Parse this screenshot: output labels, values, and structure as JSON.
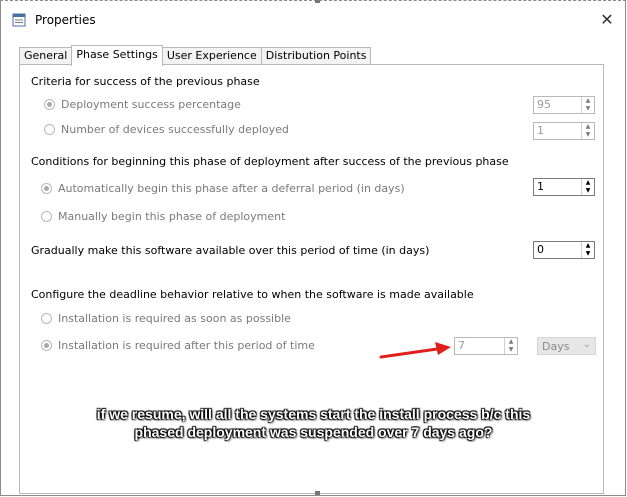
{
  "window": {
    "title": "Properties",
    "close_glyph": "✕"
  },
  "tabs": [
    {
      "label": "General",
      "active": false
    },
    {
      "label": "Phase Settings",
      "active": true
    },
    {
      "label": "User Experience",
      "active": false
    },
    {
      "label": "Distribution Points",
      "active": false
    }
  ],
  "criteria": {
    "heading": "Criteria for success of the previous phase",
    "option_percentage": "Deployment success percentage",
    "option_devices": "Number of devices successfully deployed",
    "percentage_value": "95",
    "devices_value": "1"
  },
  "conditions": {
    "heading": "Conditions for beginning this phase of deployment after success of the previous phase",
    "option_auto": "Automatically begin this phase after a deferral period (in days)",
    "option_manual": "Manually begin this phase of deployment",
    "deferral_value": "1"
  },
  "gradual": {
    "label": "Gradually make this software available over this period of time (in days)",
    "value": "0"
  },
  "deadline": {
    "heading": "Configure the deadline behavior relative to when the software is made available",
    "option_asap": "Installation is required as soon as possible",
    "option_after": "Installation is required after this period of time",
    "period_value": "7",
    "unit_value": "Days"
  },
  "annotation": {
    "line1": "if we resume, will all the systems start the install process b/c this",
    "line2": "phased deployment was suspended over 7 days ago?"
  },
  "colors": {
    "arrow": "#e0201a"
  }
}
